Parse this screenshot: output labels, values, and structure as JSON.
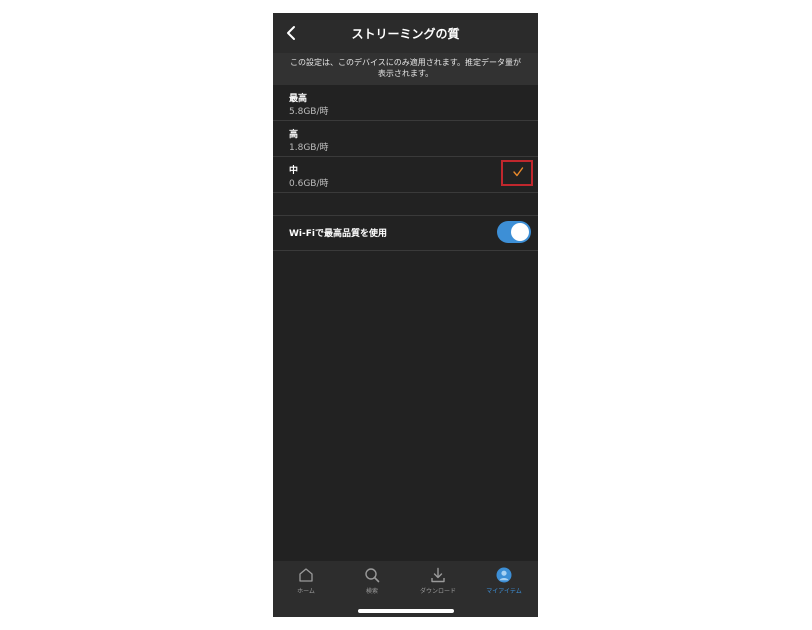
{
  "header": {
    "title": "ストリーミングの質",
    "back_icon": "chevron-left-icon"
  },
  "notice": {
    "text": "この設定は、このデバイスにのみ適用されます。推定データ量が表示されます。"
  },
  "quality_options": [
    {
      "name": "最高",
      "rate": "5.8GB/時",
      "selected": false
    },
    {
      "name": "高",
      "rate": "1.8GB/時",
      "selected": false
    },
    {
      "name": "中",
      "rate": "0.6GB/時",
      "selected": true
    }
  ],
  "wifi_setting": {
    "label": "Wi-Fiで最高品質を使用",
    "enabled": true
  },
  "tabbar": {
    "tabs": [
      {
        "label": "ホーム",
        "icon": "home-icon",
        "active": false
      },
      {
        "label": "検索",
        "icon": "search-icon",
        "active": false
      },
      {
        "label": "ダウンロード",
        "icon": "download-icon",
        "active": false
      },
      {
        "label": "マイアイテム",
        "icon": "profile-icon",
        "active": true
      }
    ]
  },
  "colors": {
    "accent": "#3d8fd6",
    "check": "#e8892b",
    "highlight_border": "#c0272d",
    "background": "#222222"
  }
}
